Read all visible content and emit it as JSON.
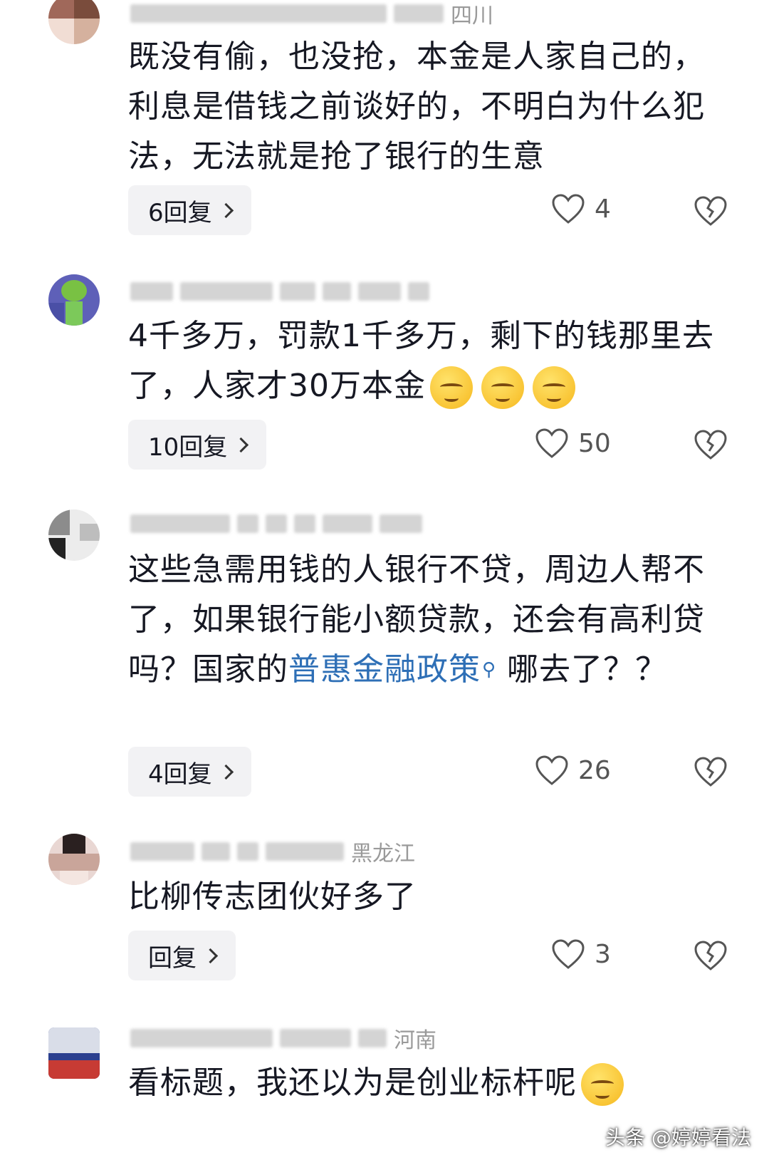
{
  "comments": [
    {
      "region": "四川",
      "text": "既没有偷，也没抢，本金是人家自己的，利息是借钱之前谈好的，不明白为什么犯法，无法就是抢了银行的生意",
      "replies": "6回复",
      "likes": "4"
    },
    {
      "region": "",
      "text": "4千多万，罚款1千多万，剩下的钱那里去了，人家才30万本金",
      "replies": "10回复",
      "likes": "50"
    },
    {
      "region": "",
      "text_before": "这些急需用钱的人银行不贷，周边人帮不了，如果银行能小额贷款，还会有高利贷吗？国家的",
      "link": "普惠金融政策",
      "text_after": " 哪去了？？",
      "replies": "4回复",
      "likes": "26"
    },
    {
      "region": "黑龙江",
      "text": "比柳传志团伙好多了",
      "replies": "回复",
      "likes": "3"
    },
    {
      "region": "河南",
      "text": "看标题，我还以为是创业标杆呢"
    }
  ],
  "watermark": "头条 @婷婷看法",
  "icons": {
    "like": "heart-outline-icon",
    "dislike": "broken-heart-icon",
    "reply_chevron": "chevron-right-icon",
    "link_search": "search-icon"
  },
  "colors": {
    "link": "#2e6fb6",
    "text": "#161823",
    "meta": "#9a9a9a",
    "reply_bg": "#f2f2f4"
  }
}
